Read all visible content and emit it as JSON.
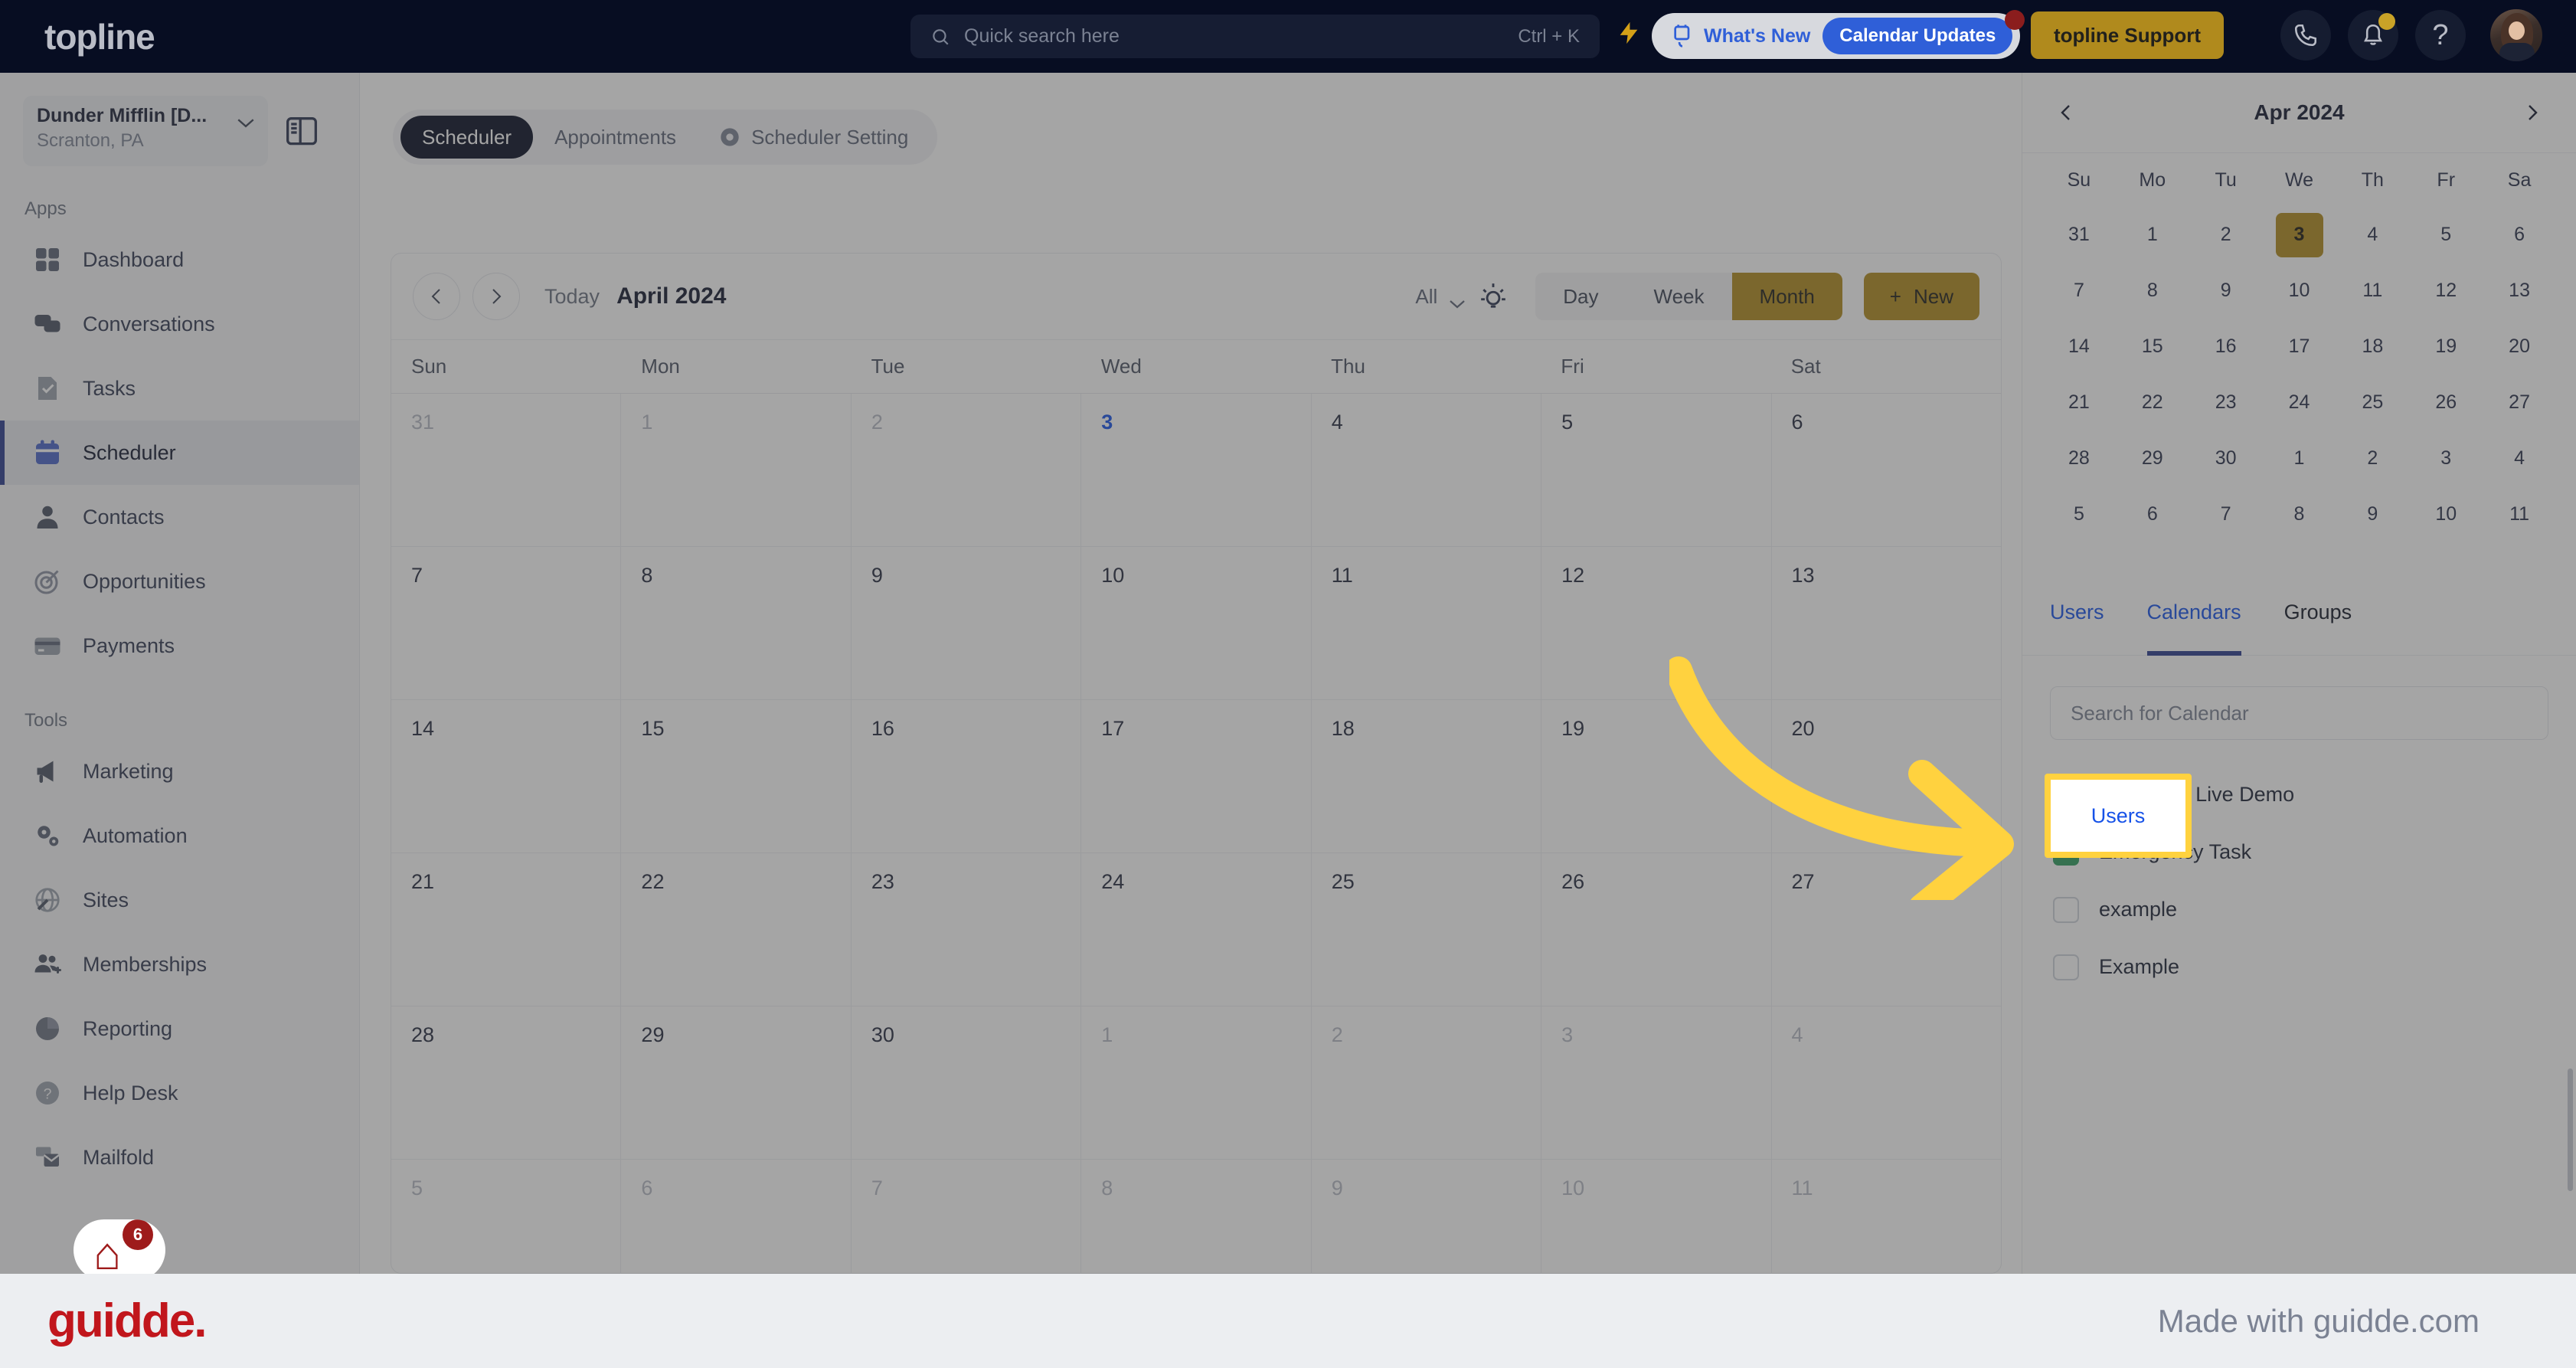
{
  "topbar": {
    "brand": "topline",
    "search_placeholder": "Quick search here",
    "search_shortcut": "Ctrl + K",
    "whats_new_label": "What's New",
    "whats_new_badge": "Calendar Updates",
    "support_label": "topline Support",
    "icons": [
      "bolt-icon",
      "megaphone-icon",
      "phone-icon",
      "bell-icon",
      "help-icon",
      "avatar"
    ]
  },
  "sidebar": {
    "location_name": "Dunder Mifflin [D...",
    "location_sub": "Scranton, PA",
    "section_apps": "Apps",
    "section_tools": "Tools",
    "apps": [
      {
        "label": "Dashboard",
        "icon": "dashboard-icon",
        "active": false
      },
      {
        "label": "Conversations",
        "icon": "chat-icon",
        "active": false
      },
      {
        "label": "Tasks",
        "icon": "task-icon",
        "active": false
      },
      {
        "label": "Scheduler",
        "icon": "calendar-icon",
        "active": true
      },
      {
        "label": "Contacts",
        "icon": "person-icon",
        "active": false
      },
      {
        "label": "Opportunities",
        "icon": "target-icon",
        "active": false
      },
      {
        "label": "Payments",
        "icon": "card-icon",
        "active": false
      }
    ],
    "tools": [
      {
        "label": "Marketing",
        "icon": "megaphone-icon",
        "active": false
      },
      {
        "label": "Automation",
        "icon": "gears-icon",
        "active": false
      },
      {
        "label": "Sites",
        "icon": "globe-icon",
        "active": false
      },
      {
        "label": "Memberships",
        "icon": "people-icon",
        "active": false
      },
      {
        "label": "Reporting",
        "icon": "pie-chart-icon",
        "active": false
      },
      {
        "label": "Help Desk",
        "icon": "question-circle-icon",
        "active": false
      },
      {
        "label": "Mailfold",
        "icon": "mail-stack-icon",
        "active": false
      }
    ],
    "mail_badge_count": "6"
  },
  "main": {
    "tabs": [
      {
        "label": "Scheduler",
        "active": true,
        "icon": ""
      },
      {
        "label": "Appointments",
        "active": false,
        "icon": ""
      },
      {
        "label": "Scheduler Setting",
        "active": false,
        "icon": "gear-icon"
      }
    ],
    "toolbar": {
      "prev_icon": "chevron-left-icon",
      "next_icon": "chevron-right-icon",
      "today_label": "Today",
      "month_label": "April 2024",
      "filter_label": "All",
      "bulb_icon": "lightbulb-icon",
      "views": [
        {
          "label": "Day",
          "active": false
        },
        {
          "label": "Week",
          "active": false
        },
        {
          "label": "Month",
          "active": true
        }
      ],
      "new_label": "New"
    },
    "day_headers": [
      "Sun",
      "Mon",
      "Tue",
      "Wed",
      "Thu",
      "Fri",
      "Sat"
    ],
    "weeks": [
      [
        {
          "n": "31",
          "muted": true,
          "today": false
        },
        {
          "n": "1",
          "muted": true,
          "today": false
        },
        {
          "n": "2",
          "muted": true,
          "today": false
        },
        {
          "n": "3",
          "muted": false,
          "today": true
        },
        {
          "n": "4",
          "muted": false,
          "today": false
        },
        {
          "n": "5",
          "muted": false,
          "today": false
        },
        {
          "n": "6",
          "muted": false,
          "today": false
        }
      ],
      [
        {
          "n": "7",
          "muted": false,
          "today": false
        },
        {
          "n": "8",
          "muted": false,
          "today": false
        },
        {
          "n": "9",
          "muted": false,
          "today": false
        },
        {
          "n": "10",
          "muted": false,
          "today": false
        },
        {
          "n": "11",
          "muted": false,
          "today": false
        },
        {
          "n": "12",
          "muted": false,
          "today": false
        },
        {
          "n": "13",
          "muted": false,
          "today": false
        }
      ],
      [
        {
          "n": "14",
          "muted": false,
          "today": false
        },
        {
          "n": "15",
          "muted": false,
          "today": false
        },
        {
          "n": "16",
          "muted": false,
          "today": false
        },
        {
          "n": "17",
          "muted": false,
          "today": false
        },
        {
          "n": "18",
          "muted": false,
          "today": false
        },
        {
          "n": "19",
          "muted": false,
          "today": false
        },
        {
          "n": "20",
          "muted": false,
          "today": false
        }
      ],
      [
        {
          "n": "21",
          "muted": false,
          "today": false
        },
        {
          "n": "22",
          "muted": false,
          "today": false
        },
        {
          "n": "23",
          "muted": false,
          "today": false
        },
        {
          "n": "24",
          "muted": false,
          "today": false
        },
        {
          "n": "25",
          "muted": false,
          "today": false
        },
        {
          "n": "26",
          "muted": false,
          "today": false
        },
        {
          "n": "27",
          "muted": false,
          "today": false
        }
      ],
      [
        {
          "n": "28",
          "muted": false,
          "today": false
        },
        {
          "n": "29",
          "muted": false,
          "today": false
        },
        {
          "n": "30",
          "muted": false,
          "today": false
        },
        {
          "n": "1",
          "muted": true,
          "today": false
        },
        {
          "n": "2",
          "muted": true,
          "today": false
        },
        {
          "n": "3",
          "muted": true,
          "today": false
        },
        {
          "n": "4",
          "muted": true,
          "today": false
        }
      ],
      [
        {
          "n": "5",
          "muted": true,
          "today": false
        },
        {
          "n": "6",
          "muted": true,
          "today": false
        },
        {
          "n": "7",
          "muted": true,
          "today": false
        },
        {
          "n": "8",
          "muted": true,
          "today": false
        },
        {
          "n": "9",
          "muted": true,
          "today": false
        },
        {
          "n": "10",
          "muted": true,
          "today": false
        },
        {
          "n": "11",
          "muted": true,
          "today": false
        }
      ]
    ]
  },
  "right_panel": {
    "mini_title": "Apr 2024",
    "prev_icon": "chevron-left-icon",
    "next_icon": "chevron-right-icon",
    "dow": [
      "Su",
      "Mo",
      "Tu",
      "We",
      "Th",
      "Fr",
      "Sa"
    ],
    "mini_weeks": [
      [
        {
          "n": "31",
          "sel": false
        },
        {
          "n": "1",
          "sel": false
        },
        {
          "n": "2",
          "sel": false
        },
        {
          "n": "3",
          "sel": true
        },
        {
          "n": "4",
          "sel": false
        },
        {
          "n": "5",
          "sel": false
        },
        {
          "n": "6",
          "sel": false
        }
      ],
      [
        {
          "n": "7",
          "sel": false
        },
        {
          "n": "8",
          "sel": false
        },
        {
          "n": "9",
          "sel": false
        },
        {
          "n": "10",
          "sel": false
        },
        {
          "n": "11",
          "sel": false
        },
        {
          "n": "12",
          "sel": false
        },
        {
          "n": "13",
          "sel": false
        }
      ],
      [
        {
          "n": "14",
          "sel": false
        },
        {
          "n": "15",
          "sel": false
        },
        {
          "n": "16",
          "sel": false
        },
        {
          "n": "17",
          "sel": false
        },
        {
          "n": "18",
          "sel": false
        },
        {
          "n": "19",
          "sel": false
        },
        {
          "n": "20",
          "sel": false
        }
      ],
      [
        {
          "n": "21",
          "sel": false
        },
        {
          "n": "22",
          "sel": false
        },
        {
          "n": "23",
          "sel": false
        },
        {
          "n": "24",
          "sel": false
        },
        {
          "n": "25",
          "sel": false
        },
        {
          "n": "26",
          "sel": false
        },
        {
          "n": "27",
          "sel": false
        }
      ],
      [
        {
          "n": "28",
          "sel": false
        },
        {
          "n": "29",
          "sel": false
        },
        {
          "n": "30",
          "sel": false
        },
        {
          "n": "1",
          "sel": false
        },
        {
          "n": "2",
          "sel": false
        },
        {
          "n": "3",
          "sel": false
        },
        {
          "n": "4",
          "sel": false
        }
      ],
      [
        {
          "n": "5",
          "sel": false
        },
        {
          "n": "6",
          "sel": false
        },
        {
          "n": "7",
          "sel": false
        },
        {
          "n": "8",
          "sel": false
        },
        {
          "n": "9",
          "sel": false
        },
        {
          "n": "10",
          "sel": false
        },
        {
          "n": "11",
          "sel": false
        }
      ]
    ],
    "tabs": [
      {
        "label": "Users",
        "state": "highlighted"
      },
      {
        "label": "Calendars",
        "state": "active"
      },
      {
        "label": "Groups",
        "state": "normal"
      }
    ],
    "search_placeholder": "Search for Calendar",
    "calendars": [
      {
        "label": "30 Minute Live Demo",
        "checked": true
      },
      {
        "label": "Emergency Task",
        "checked": true
      },
      {
        "label": "example",
        "checked": false
      },
      {
        "label": "Example",
        "checked": false
      }
    ]
  },
  "highlight": {
    "label": "Users",
    "border_color": "#ffd23f",
    "arrow_color": "#ffd23f"
  },
  "footer": {
    "logo": "guidde.",
    "tagline": "Made with guidde.com",
    "logo_color": "#c1161c"
  }
}
